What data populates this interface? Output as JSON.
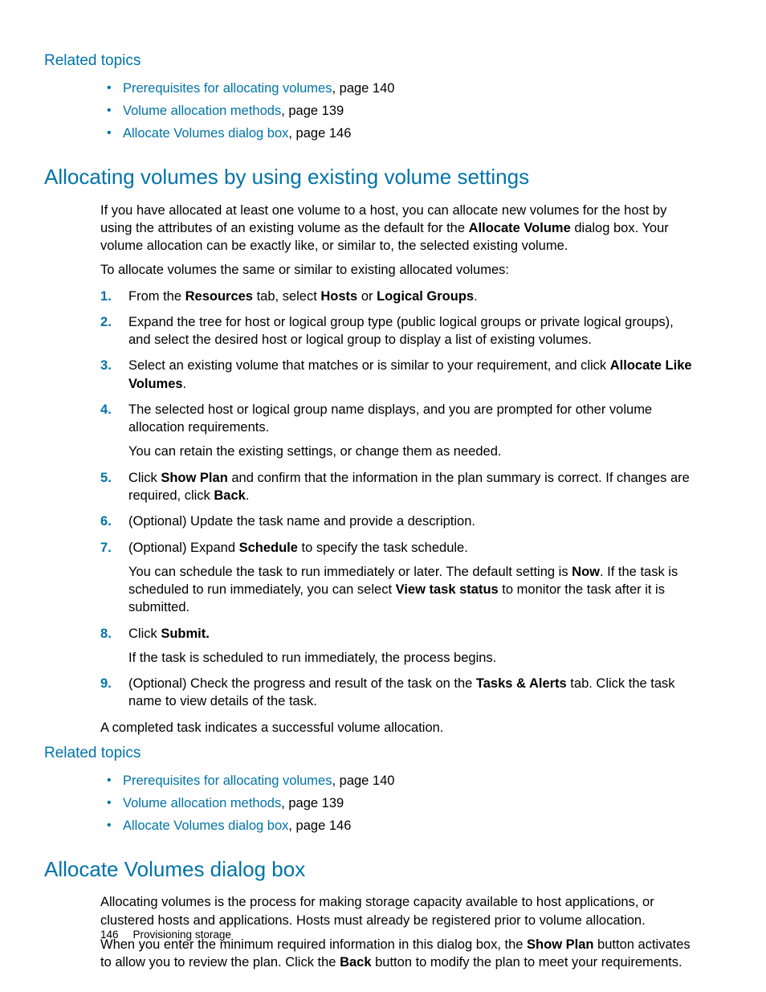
{
  "related1": {
    "heading": "Related topics",
    "items": [
      {
        "link": "Prerequisites for allocating volumes",
        "suffix": ", page 140"
      },
      {
        "link": "Volume allocation methods",
        "suffix": ", page 139"
      },
      {
        "link": "Allocate Volumes dialog box",
        "suffix": ", page 146"
      }
    ]
  },
  "sec1": {
    "heading": "Allocating volumes by using existing volume settings",
    "intro_a": "If you have allocated at least one volume to a host, you can allocate new volumes for the host by using the attributes of an existing volume as the default for the ",
    "intro_b_bold": "Allocate Volume",
    "intro_c": " dialog box. Your volume allocation can be exactly like, or similar to, the selected existing volume.",
    "lead": "To allocate volumes the same or similar to existing allocated volumes:",
    "step1_a": "From the ",
    "step1_b": "Resources",
    "step1_c": " tab, select ",
    "step1_d": "Hosts",
    "step1_e": " or ",
    "step1_f": "Logical Groups",
    "step1_g": ".",
    "step2": "Expand the tree for host or logical group type (public logical groups or private logical groups), and select the desired host or logical group to display a list of existing volumes.",
    "step3_a": "Select an existing volume that matches or is similar to your requirement, and click ",
    "step3_b": "Allocate Like Volumes",
    "step3_c": ".",
    "step4_a": "The selected host or logical group name displays, and you are prompted for other volume allocation requirements.",
    "step4_b": "You can retain the existing settings, or change them as needed.",
    "step5_a": "Click ",
    "step5_b": "Show Plan",
    "step5_c": " and confirm that the information in the plan summary is correct. If changes are required, click ",
    "step5_d": "Back",
    "step5_e": ".",
    "step6": "(Optional) Update the task name and provide a description.",
    "step7_a": "(Optional) Expand ",
    "step7_b": "Schedule",
    "step7_c": " to specify the task schedule.",
    "step7_d_a": "You can schedule the task to run immediately or later. The default setting is ",
    "step7_d_b": "Now",
    "step7_d_c": ". If the task is scheduled to run immediately, you can select ",
    "step7_d_d": "View task status",
    "step7_d_e": " to monitor the task after it is submitted.",
    "step8_a": "Click ",
    "step8_b": "Submit.",
    "step8_c": "If the task is scheduled to run immediately, the process begins.",
    "step9_a": "(Optional) Check the progress and result of the task on the ",
    "step9_b": "Tasks & Alerts",
    "step9_c": " tab. Click the task name to view details of the task.",
    "closing": "A completed task indicates a successful volume allocation."
  },
  "related2": {
    "heading": "Related topics",
    "items": [
      {
        "link": "Prerequisites for allocating volumes",
        "suffix": ", page 140"
      },
      {
        "link": "Volume allocation methods",
        "suffix": ", page 139"
      },
      {
        "link": "Allocate Volumes dialog box",
        "suffix": ", page 146"
      }
    ]
  },
  "sec2": {
    "heading": "Allocate Volumes dialog box",
    "p1": "Allocating volumes is the process for making storage capacity available to host applications, or clustered hosts and applications. Hosts must already be registered prior to volume allocation.",
    "p2_a": "When you enter the minimum required information in this dialog box, the ",
    "p2_b": "Show Plan",
    "p2_c": " button activates to allow you to review the plan. Click the ",
    "p2_d": "Back",
    "p2_e": " button to modify the plan to meet your requirements."
  },
  "footer": {
    "page": "146",
    "chapter": "Provisioning storage"
  }
}
